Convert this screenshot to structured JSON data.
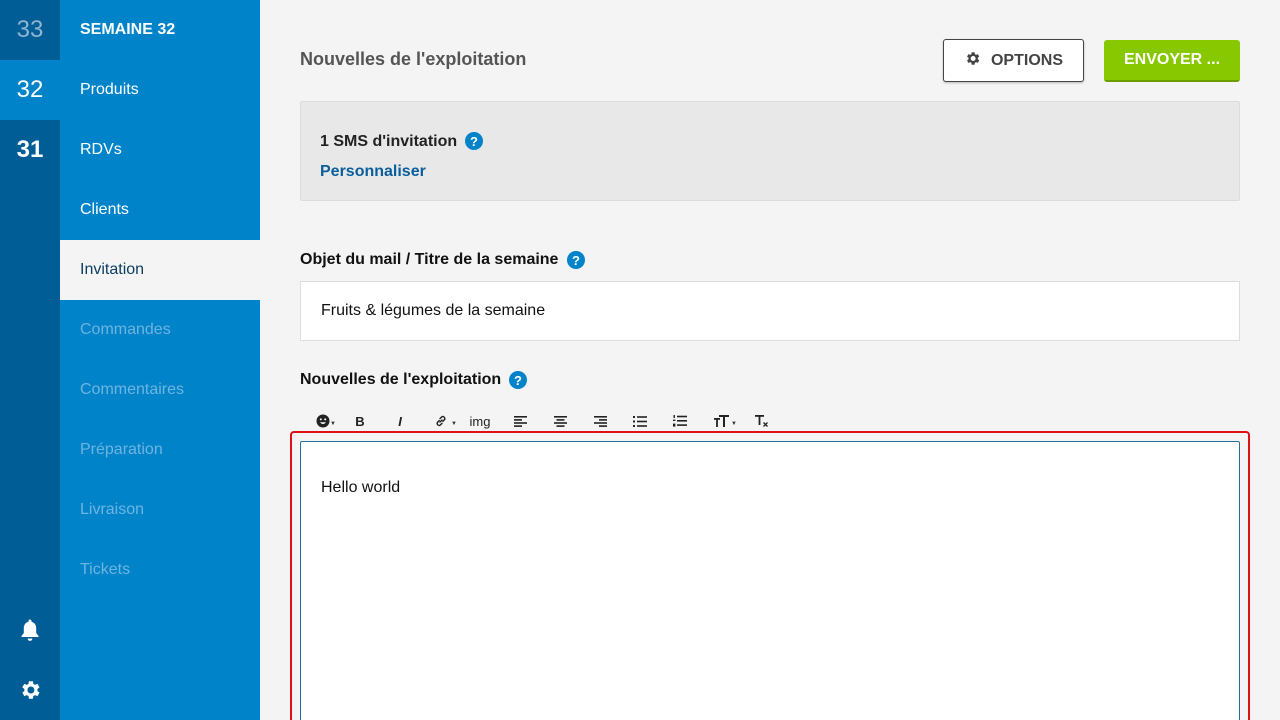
{
  "weeks": [
    {
      "number": "33",
      "state": "future"
    },
    {
      "number": "32",
      "state": "selected"
    },
    {
      "number": "31",
      "state": "current"
    }
  ],
  "rail_icons": [
    "bell-icon",
    "gear-icon"
  ],
  "menu": {
    "title": "SEMAINE 32",
    "items": [
      {
        "label": "Produits",
        "state": "enabled"
      },
      {
        "label": "RDVs",
        "state": "enabled"
      },
      {
        "label": "Clients",
        "state": "enabled"
      },
      {
        "label": "Invitation",
        "state": "active"
      },
      {
        "label": "Commandes",
        "state": "disabled"
      },
      {
        "label": "Commentaires",
        "state": "disabled"
      },
      {
        "label": "Préparation",
        "state": "disabled"
      },
      {
        "label": "Livraison",
        "state": "disabled"
      },
      {
        "label": "Tickets",
        "state": "disabled"
      }
    ]
  },
  "header": {
    "title": "Nouvelles de l'exploitation",
    "options_label": "OPTIONS",
    "send_label": "ENVOYER ..."
  },
  "sms": {
    "label": "1 SMS d'invitation",
    "help": "?",
    "link": "Personnaliser"
  },
  "subject": {
    "label": "Objet du mail / Titre de la semaine",
    "help": "?",
    "value": "Fruits & légumes de la semaine"
  },
  "news": {
    "label": "Nouvelles de l'exploitation",
    "help": "?",
    "toolbar": {
      "bold": "B",
      "italic": "I",
      "image": "img"
    },
    "content": "Hello world"
  },
  "colors": {
    "rail": "#005d96",
    "menu": "#0083c9",
    "accent_green": "#87c800",
    "highlight_border": "#e0101a"
  }
}
